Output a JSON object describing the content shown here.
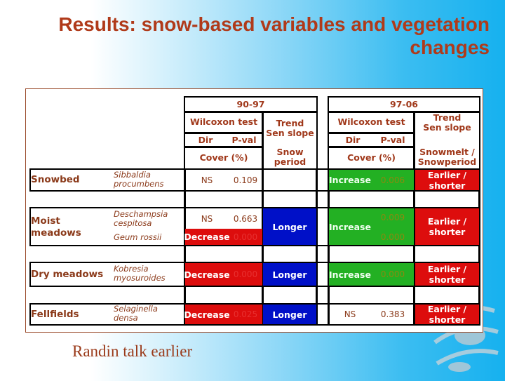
{
  "slide": {
    "title": "Results: snow-based variables and vegetation changes",
    "footnote": "Randin talk earlier"
  },
  "colors": {
    "title": "#b03a1a",
    "decrease_bg": "#dd0d0d",
    "increase_bg": "#23b023",
    "longer_bg": "#0010c8",
    "earlier_bg": "#dd0d0d",
    "header_text": "#a0381a"
  },
  "table": {
    "periods": [
      {
        "label": "90-97",
        "wilcoxon": "Wilcoxon test",
        "dir": "Dir",
        "pval": "P-val",
        "cover": "Cover (%)",
        "trend": "Trend\nSen slope",
        "trend_line1": "Trend",
        "trend_line2": "Sen slope",
        "variable_line1": "Snow",
        "variable_line2": "period"
      },
      {
        "label": "97-06",
        "wilcoxon": "Wilcoxon test",
        "dir": "Dir",
        "pval": "P-val",
        "cover": "Cover (%)",
        "trend_line1": "Trend",
        "trend_line2": "Sen slope",
        "variable_line1": "Snowmelt /",
        "variable_line2": "Snowperiod"
      }
    ],
    "rows": [
      {
        "habitat": "Snowbed",
        "species": [
          {
            "line1": "Sibbaldia",
            "line2": "procumbens"
          }
        ],
        "p1": [
          {
            "dir": "NS",
            "pval": "0.109",
            "status": "ns"
          }
        ],
        "p1_trend": "",
        "p2": {
          "dir": "Increase",
          "pvals": [
            "0.006"
          ],
          "status": "increase"
        },
        "p2_trend_line1": "Earlier /",
        "p2_trend_line2": "shorter"
      },
      {
        "habitat_line1": "Moist",
        "habitat_line2": "meadows",
        "species": [
          {
            "line1": "Deschampsia",
            "line2": "cespitosa"
          },
          {
            "line1": "Geum rossii"
          }
        ],
        "p1": [
          {
            "dir": "NS",
            "pval": "0.663",
            "status": "ns"
          },
          {
            "dir": "Decrease",
            "pval": "0.000",
            "status": "decrease"
          }
        ],
        "p1_trend": "Longer",
        "p2": {
          "dir": "Increase",
          "pvals": [
            "0.009",
            "0.000"
          ],
          "status": "increase"
        },
        "p2_trend_line1": "Earlier /",
        "p2_trend_line2": "shorter"
      },
      {
        "habitat": "Dry meadows",
        "species": [
          {
            "line1": "Kobresia",
            "line2": "myosuroides"
          }
        ],
        "p1": [
          {
            "dir": "Decrease",
            "pval": "0.000",
            "status": "decrease"
          }
        ],
        "p1_trend": "Longer",
        "p2": {
          "dir": "Increase",
          "pvals": [
            "0.000"
          ],
          "status": "increase"
        },
        "p2_trend_line1": "Earlier /",
        "p2_trend_line2": "shorter"
      },
      {
        "habitat": "Fellfields",
        "species": [
          {
            "line1": "Selaginella",
            "line2": "densa"
          }
        ],
        "p1": [
          {
            "dir": "Decrease",
            "pval": "0.025",
            "status": "decrease"
          }
        ],
        "p1_trend": "Longer",
        "p2": {
          "dir": "NS",
          "pvals": [
            "0.383"
          ],
          "status": "ns"
        },
        "p2_trend_line1": "Earlier /",
        "p2_trend_line2": "shorter"
      }
    ]
  },
  "icons": {
    "logo": "globe-logo-icon"
  }
}
